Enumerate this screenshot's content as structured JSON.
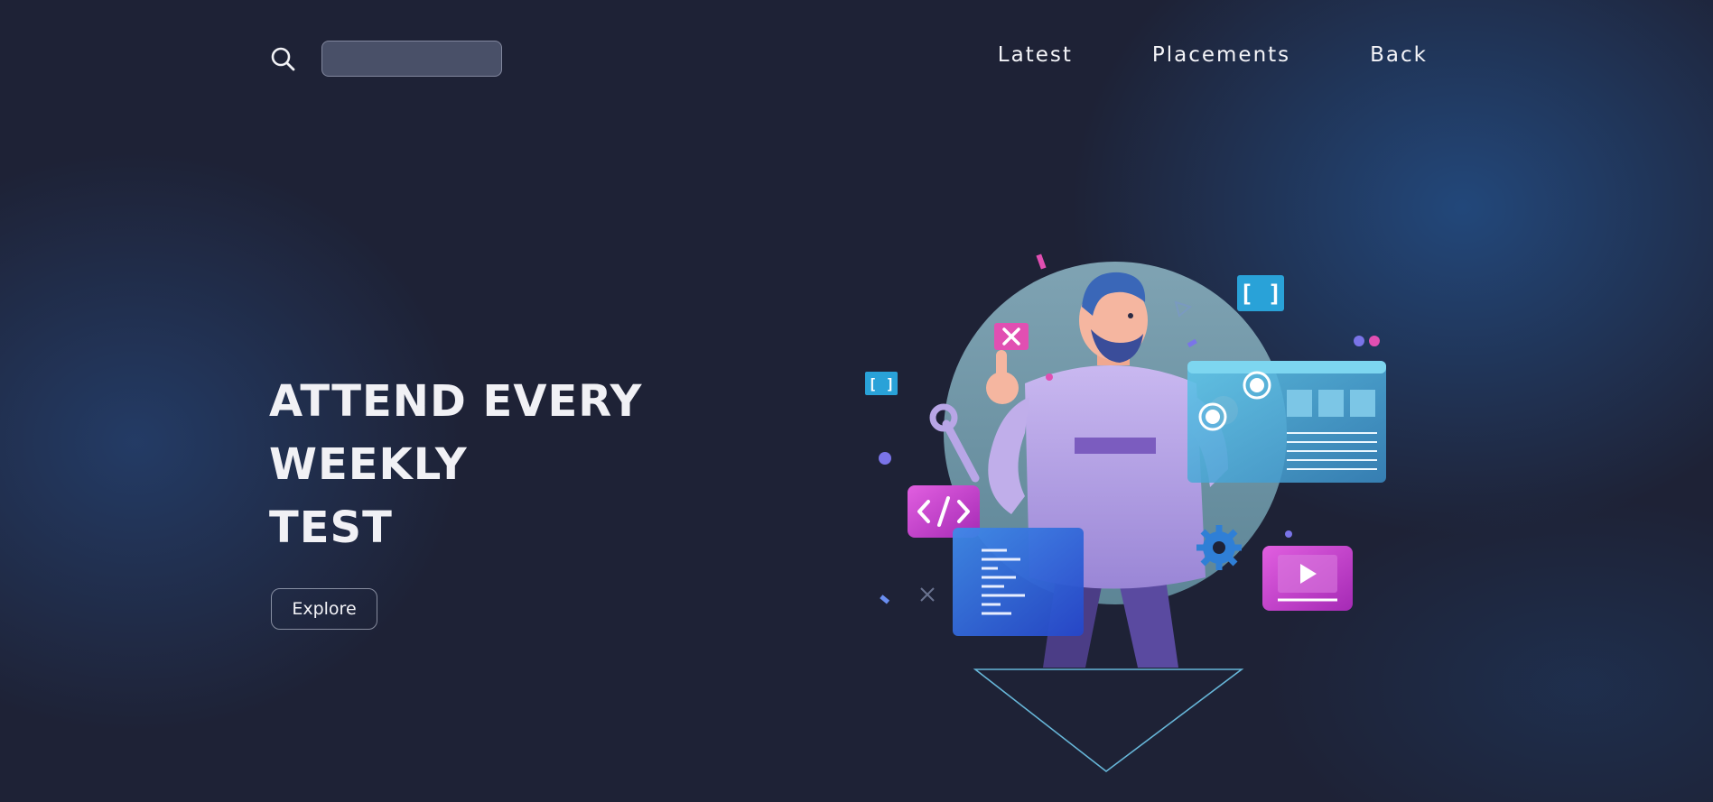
{
  "header": {
    "search": {
      "icon": "search-icon",
      "placeholder": "",
      "value": ""
    },
    "nav": [
      {
        "label": "Latest"
      },
      {
        "label": "Placements"
      },
      {
        "label": "Back"
      }
    ]
  },
  "hero": {
    "title_lines": [
      "ATTEND EVERY",
      "WEEKLY",
      "TEST"
    ],
    "button_label": "Explore"
  },
  "illustration": {
    "icons": [
      "close-icon",
      "code-icon",
      "brackets-icon",
      "gear-icon",
      "wrench-icon",
      "play-icon",
      "web-window-icon",
      "document-icon",
      "arrow-down-icon"
    ]
  },
  "colors": {
    "background": "#1e2236",
    "glow": "#24548f",
    "accent_magenta": "#c040c8",
    "accent_blue": "#2f6fe0",
    "accent_cyan": "#2aa7d8"
  }
}
